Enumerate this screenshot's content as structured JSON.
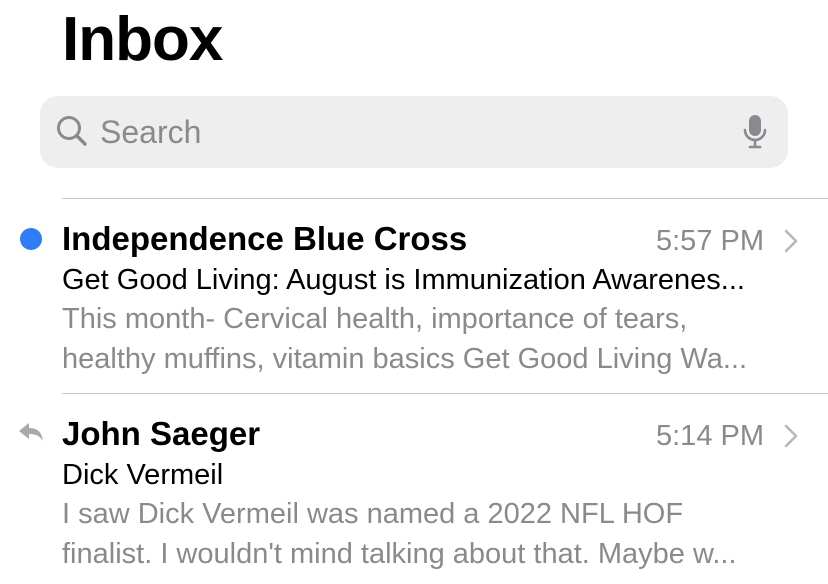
{
  "header": {
    "title": "Inbox"
  },
  "search": {
    "placeholder": "Search",
    "left_icon": "search-icon",
    "right_icon": "microphone-icon"
  },
  "colors": {
    "unread_dot": "#2f7cf6",
    "secondary_text": "#8a8a8e",
    "search_background": "#eeeeef"
  },
  "messages": [
    {
      "sender": "Independence Blue Cross",
      "time": "5:57 PM",
      "subject": "Get Good Living: August is Immunization Awarenes...",
      "preview_line1": "This month- Cervical health, importance of tears,",
      "preview_line2": "healthy muffins, vitamin basics Get Good Living Wa...",
      "status_icon": "unread-dot",
      "accessory_icon": "chevron-right-icon"
    },
    {
      "sender": "John Saeger",
      "time": "5:14 PM",
      "subject": "Dick Vermeil",
      "preview_line1": "I saw Dick Vermeil was named a 2022 NFL HOF",
      "preview_line2": "finalist. I wouldn't mind talking about that. Maybe w...",
      "status_icon": "replied-arrow-icon",
      "accessory_icon": "chevron-right-icon"
    }
  ]
}
